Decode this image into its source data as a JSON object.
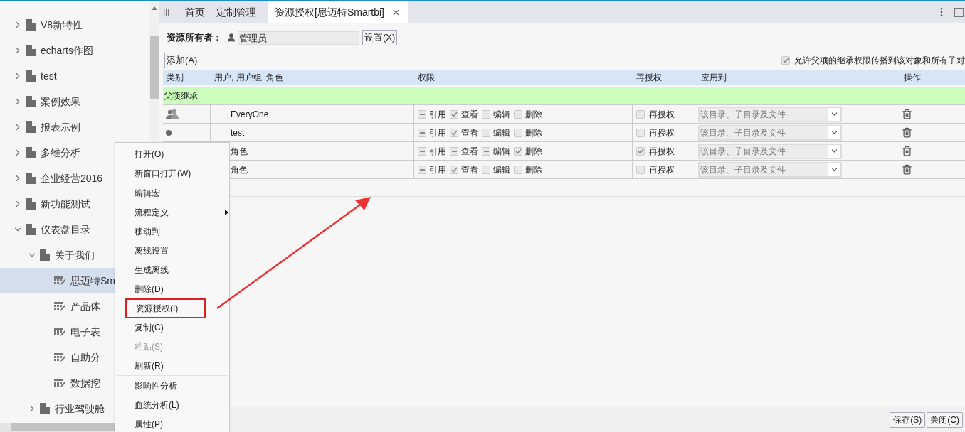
{
  "sidebar": {
    "items": [
      {
        "label": "V8新特性",
        "kind": "folder",
        "expanded": false,
        "selected": false
      },
      {
        "label": "echarts作图",
        "kind": "folder",
        "expanded": false,
        "selected": false
      },
      {
        "label": "test",
        "kind": "folder",
        "expanded": false,
        "selected": false
      },
      {
        "label": "案例效果",
        "kind": "folder",
        "expanded": false,
        "selected": false
      },
      {
        "label": "报表示例",
        "kind": "folder",
        "expanded": false,
        "selected": false
      },
      {
        "label": "多维分析",
        "kind": "folder",
        "expanded": false,
        "selected": false
      },
      {
        "label": "企业经营2016",
        "kind": "folder",
        "expanded": false,
        "selected": false
      },
      {
        "label": "新功能测试",
        "kind": "folder",
        "expanded": false,
        "selected": false
      },
      {
        "label": "仪表盘目录",
        "kind": "folder",
        "expanded": true,
        "selected": false,
        "children": [
          {
            "label": "关于我们",
            "kind": "folder",
            "expanded": true,
            "selected": false,
            "children": [
              {
                "label": "思迈特Sm",
                "kind": "report",
                "selected": true
              },
              {
                "label": "产品体",
                "kind": "report",
                "selected": false
              },
              {
                "label": "电子表",
                "kind": "report",
                "selected": false
              },
              {
                "label": "自助分",
                "kind": "report",
                "selected": false
              },
              {
                "label": "数据挖",
                "kind": "report",
                "selected": false
              }
            ]
          },
          {
            "label": "行业驾驶舱",
            "kind": "folder",
            "expanded": false,
            "selected": false
          }
        ]
      }
    ]
  },
  "tabs": [
    {
      "label": "首页",
      "selected": false
    },
    {
      "label": "定制管理",
      "selected": false
    },
    {
      "label": "资源授权[思迈特Smartbi]",
      "selected": true
    }
  ],
  "owner": {
    "label": "资源所有者：",
    "value": "管理员",
    "button": "设置(X)"
  },
  "add_button": "添加(A)",
  "inherit_option": {
    "label": "允许父项的继承权限传播到该对象和所有子对",
    "checked": true
  },
  "table": {
    "columns": [
      "类别",
      "用户, 用户组, 角色",
      "权限",
      "再授权",
      "应用到",
      "操作"
    ],
    "group_row": "父项继承",
    "rows": [
      {
        "kind": "group",
        "name": "EveryOne",
        "permissions": [
          {
            "label": "引用",
            "partial": true
          },
          {
            "label": "查看",
            "checked": true
          },
          {
            "label": "编辑",
            "checked": false
          },
          {
            "label": "删除",
            "checked": false
          }
        ],
        "regrant": {
          "label": "再授权",
          "checked": false
        },
        "apply_to": "该目录、子目录及文件"
      },
      {
        "kind": "user",
        "name": "test",
        "permissions": [
          {
            "label": "引用",
            "partial": true
          },
          {
            "label": "查看",
            "checked": true
          },
          {
            "label": "编辑",
            "checked": false
          },
          {
            "label": "删除",
            "checked": false
          }
        ],
        "regrant": {
          "label": "再授权",
          "checked": false
        },
        "apply_to": "该目录、子目录及文件"
      },
      {
        "name": "角色",
        "permissions": [
          {
            "label": "引用",
            "partial": true
          },
          {
            "label": "查看",
            "partial": true
          },
          {
            "label": "编辑",
            "partial": true
          },
          {
            "label": "删除",
            "checked": true
          }
        ],
        "regrant": {
          "label": "再授权",
          "checked": true
        },
        "apply_to": "该目录、子目录及文件"
      },
      {
        "name": "角色",
        "permissions": [
          {
            "label": "引用",
            "partial": true
          },
          {
            "label": "查看",
            "checked": true
          },
          {
            "label": "编辑",
            "checked": false
          },
          {
            "label": "删除",
            "checked": false
          }
        ],
        "regrant": {
          "label": "再授权",
          "checked": false
        },
        "apply_to": "该目录、子目录及文件"
      }
    ]
  },
  "footer": {
    "buttons": [
      "保存(S)",
      "关闭(C)"
    ]
  },
  "context_menu": {
    "items": [
      {
        "kind": "item",
        "label": "打开(O)",
        "disabled": false,
        "highlighted": false
      },
      {
        "kind": "item",
        "label": "新窗口打开(W)",
        "disabled": false,
        "highlighted": false
      },
      {
        "kind": "separator"
      },
      {
        "kind": "item",
        "label": "编辑宏",
        "disabled": false,
        "highlighted": false
      },
      {
        "kind": "submenu",
        "label": "流程定义",
        "disabled": false,
        "highlighted": false
      },
      {
        "kind": "item",
        "label": "移动到",
        "disabled": false,
        "highlighted": false
      },
      {
        "kind": "item",
        "label": "离线设置",
        "disabled": false,
        "highlighted": false
      },
      {
        "kind": "item",
        "label": "生成离线",
        "disabled": false,
        "highlighted": false
      },
      {
        "kind": "item",
        "label": "删除(D)",
        "disabled": false,
        "highlighted": false
      },
      {
        "kind": "item",
        "label": "资源授权(I)",
        "disabled": false,
        "highlighted": true
      },
      {
        "kind": "item",
        "label": "复制(C)",
        "disabled": false,
        "highlighted": false
      },
      {
        "kind": "item",
        "label": "粘贴(S)",
        "disabled": true,
        "highlighted": false
      },
      {
        "kind": "item",
        "label": "刷新(R)",
        "disabled": false,
        "highlighted": false
      },
      {
        "kind": "separator"
      },
      {
        "kind": "item",
        "label": "影响性分析",
        "disabled": false,
        "highlighted": false
      },
      {
        "kind": "item",
        "label": "血统分析(L)",
        "disabled": false,
        "highlighted": false
      },
      {
        "kind": "item",
        "label": "属性(P)",
        "disabled": false,
        "highlighted": false
      }
    ]
  }
}
